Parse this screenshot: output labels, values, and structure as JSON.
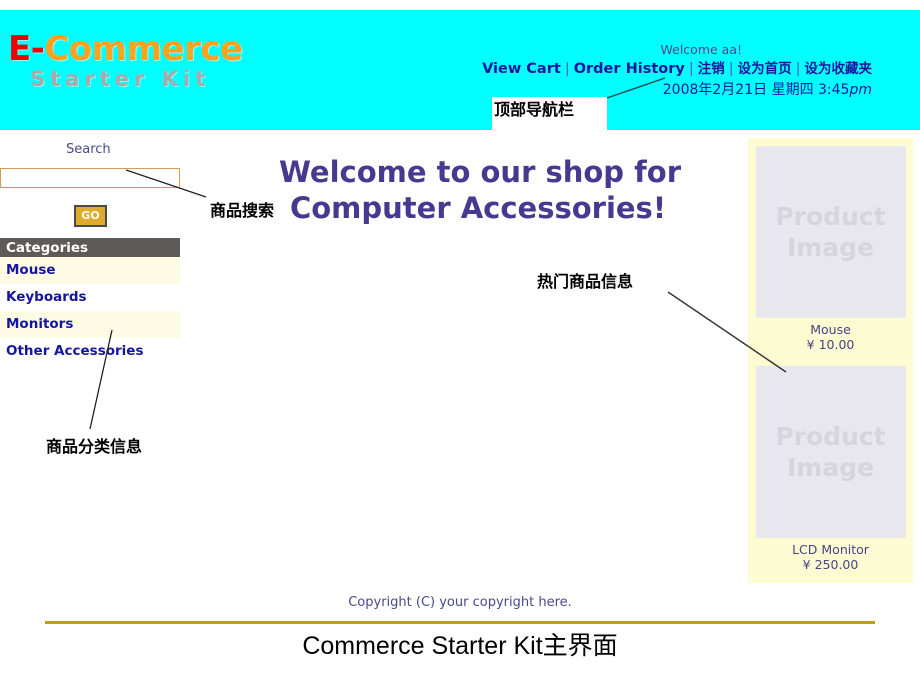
{
  "header": {
    "logo": {
      "prefix": "E-",
      "main": "Commerce",
      "subtitle": "Starter Kit"
    },
    "welcome": "Welcome aa!",
    "nav": {
      "view_cart": "View Cart",
      "order_history": "Order History",
      "logout": "注销",
      "set_homepage": "设为首页",
      "add_favorite": "设为收藏夹",
      "separator": "|"
    },
    "datetime": {
      "date": "2008年2月21日 星期四 3:45",
      "ampm": "pm"
    }
  },
  "sidebar": {
    "search_label": "Search",
    "search_value": "",
    "search_placeholder": "",
    "go_label": "GO",
    "categories_header": "Categories",
    "categories": [
      {
        "label": "Mouse"
      },
      {
        "label": "Keyboards"
      },
      {
        "label": "Monitors"
      },
      {
        "label": "Other Accessories"
      }
    ]
  },
  "main": {
    "heading_line1": "Welcome to our shop for",
    "heading_line2": "Computer Accessories!"
  },
  "products": {
    "placeholder_line1": "Product",
    "placeholder_line2": "Image",
    "items": [
      {
        "name": "Mouse",
        "price": "¥ 10.00"
      },
      {
        "name": "LCD Monitor",
        "price": "¥ 250.00"
      }
    ]
  },
  "footer": {
    "copyright": "Copyright (C) your copyright here."
  },
  "caption": "Commerce Starter Kit主界面",
  "annotations": {
    "top_nav": "顶部导航栏",
    "product_search": "商品搜索",
    "product_categories": "商品分类信息",
    "hot_products": "热门商品信息"
  },
  "colors": {
    "header_bg": "#00ffff",
    "logo_red": "#ee0000",
    "logo_orange": "#ffa21f",
    "logo_gray": "#a9a9a9",
    "link_blue": "#1515a0",
    "heading_purple": "#46398f",
    "category_header_bg": "#5e5a5a",
    "category_alt_bg": "#fdfbe4",
    "product_panel_bg": "#fdfbd2",
    "product_image_bg": "#e9e7ee",
    "go_button_bg": "#deab2c",
    "gold_rule": "#c49a19"
  }
}
